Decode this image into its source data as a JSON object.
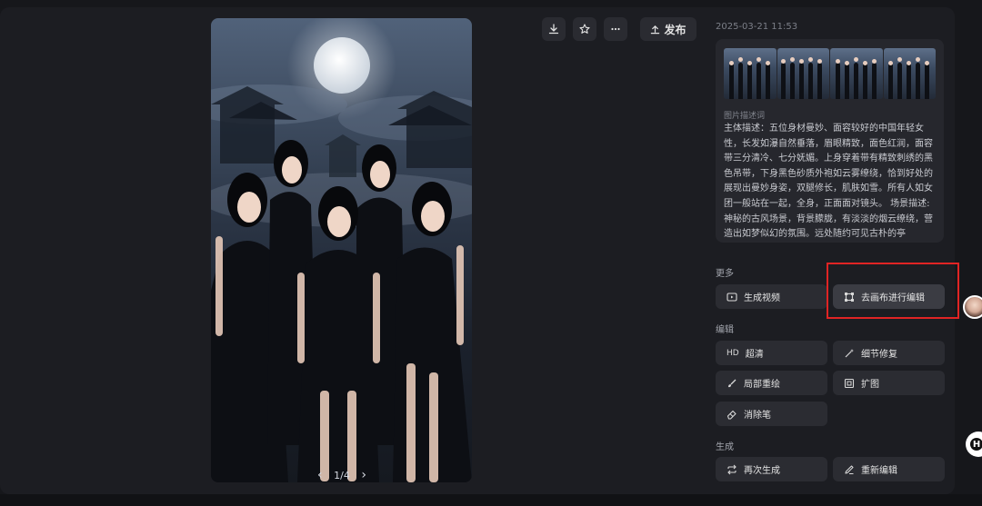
{
  "toolbar": {
    "download_icon": "download-icon",
    "favorite_icon": "star-icon",
    "more_icon": "more-icon",
    "publish_label": "发布"
  },
  "viewer": {
    "pager": "1/4"
  },
  "meta": {
    "date": "2025-03-21 11:53"
  },
  "description": {
    "label": "图片描述词",
    "text": "主体描述：五位身材曼妙、面容较好的中国年轻女性，长发如瀑自然垂落，眉眼精致，面色红润，面容带三分清冷、七分妩媚。上身穿着带有精致刺绣的黑色吊带，下身黑色砂质外袍如云雾缭绕，恰到好处的展现出曼妙身姿，双腿修长，肌肤如雪。所有人如女团一般站在一起，全身，正面面对镜头。 场景描述:神秘的古风场景，背景朦胧，有淡淡的烟云缭绕，营造出如梦似幻的氛围。远处随约可见古朴的亭"
  },
  "sections": {
    "more": "更多",
    "edit": "编辑",
    "generate": "生成"
  },
  "actions": {
    "generate_video": "生成视频",
    "canvas_edit": "去画布进行编辑",
    "hd_icon_text": "HD",
    "upscale": "超清",
    "detail_fix": "细节修复",
    "inpaint": "局部重绘",
    "expand": "扩图",
    "eraser": "消除笔",
    "regenerate": "再次生成",
    "re_edit": "重新编辑"
  },
  "floating": {
    "h_badge": "H"
  },
  "colors": {
    "highlight_border": "#e02424",
    "panel_bg": "#1c1d22",
    "button_bg": "#2b2c32"
  }
}
